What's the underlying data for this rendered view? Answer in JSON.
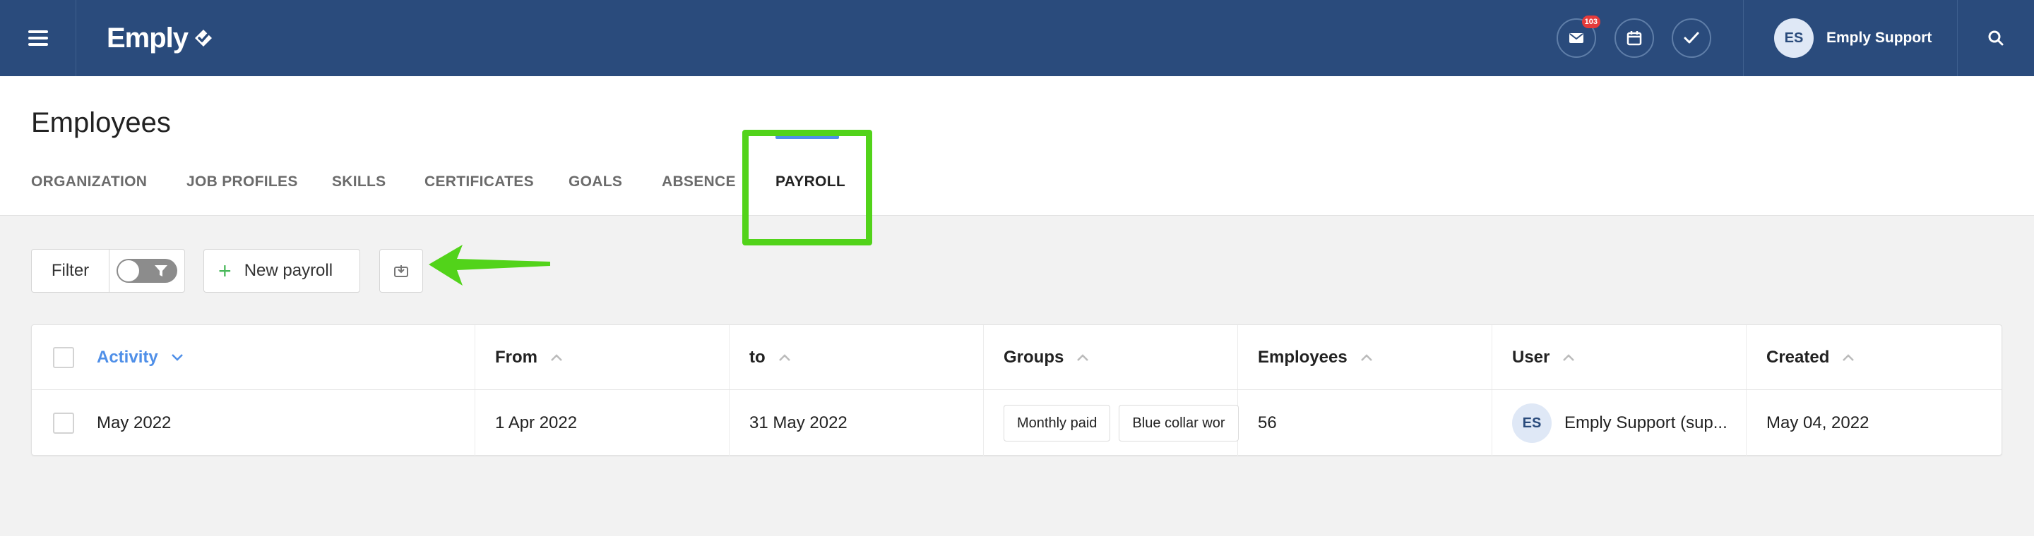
{
  "topbar": {
    "logo_text": "Emply",
    "mail_badge": "103",
    "user_initials": "ES",
    "user_name": "Emply Support",
    "icons": [
      "menu-icon",
      "mail-icon",
      "calendar-icon",
      "check-icon",
      "search-icon"
    ]
  },
  "page": {
    "title": "Employees",
    "tabs": [
      {
        "label": "ORGANIZATION"
      },
      {
        "label": "JOB PROFILES"
      },
      {
        "label": "SKILLS"
      },
      {
        "label": "CERTIFICATES"
      },
      {
        "label": "GOALS"
      },
      {
        "label": "ABSENCE"
      },
      {
        "label": "PAYROLL",
        "active": true
      }
    ]
  },
  "toolbar": {
    "filter_label": "Filter",
    "new_label": "New payroll"
  },
  "table": {
    "columns": [
      {
        "label": "Activity",
        "sort": "desc",
        "active": true
      },
      {
        "label": "From",
        "sort": "asc"
      },
      {
        "label": "to",
        "sort": "asc"
      },
      {
        "label": "Groups",
        "sort": "asc"
      },
      {
        "label": "Employees",
        "sort": "asc"
      },
      {
        "label": "User",
        "sort": "asc"
      },
      {
        "label": "Created",
        "sort": "asc"
      }
    ],
    "rows": [
      {
        "activity": "May 2022",
        "from": "1 Apr 2022",
        "to": "31 May 2022",
        "groups": [
          "Monthly paid",
          "Blue collar wor"
        ],
        "employees": "56",
        "user_initials": "ES",
        "user": "Emply Support (sup...",
        "created": "May 04, 2022"
      }
    ]
  },
  "colors": {
    "topbar": "#2a4b7c",
    "accent": "#4f8fe8",
    "highlight": "#52d31a",
    "badge": "#e53b3b",
    "plus": "#49b85a"
  }
}
